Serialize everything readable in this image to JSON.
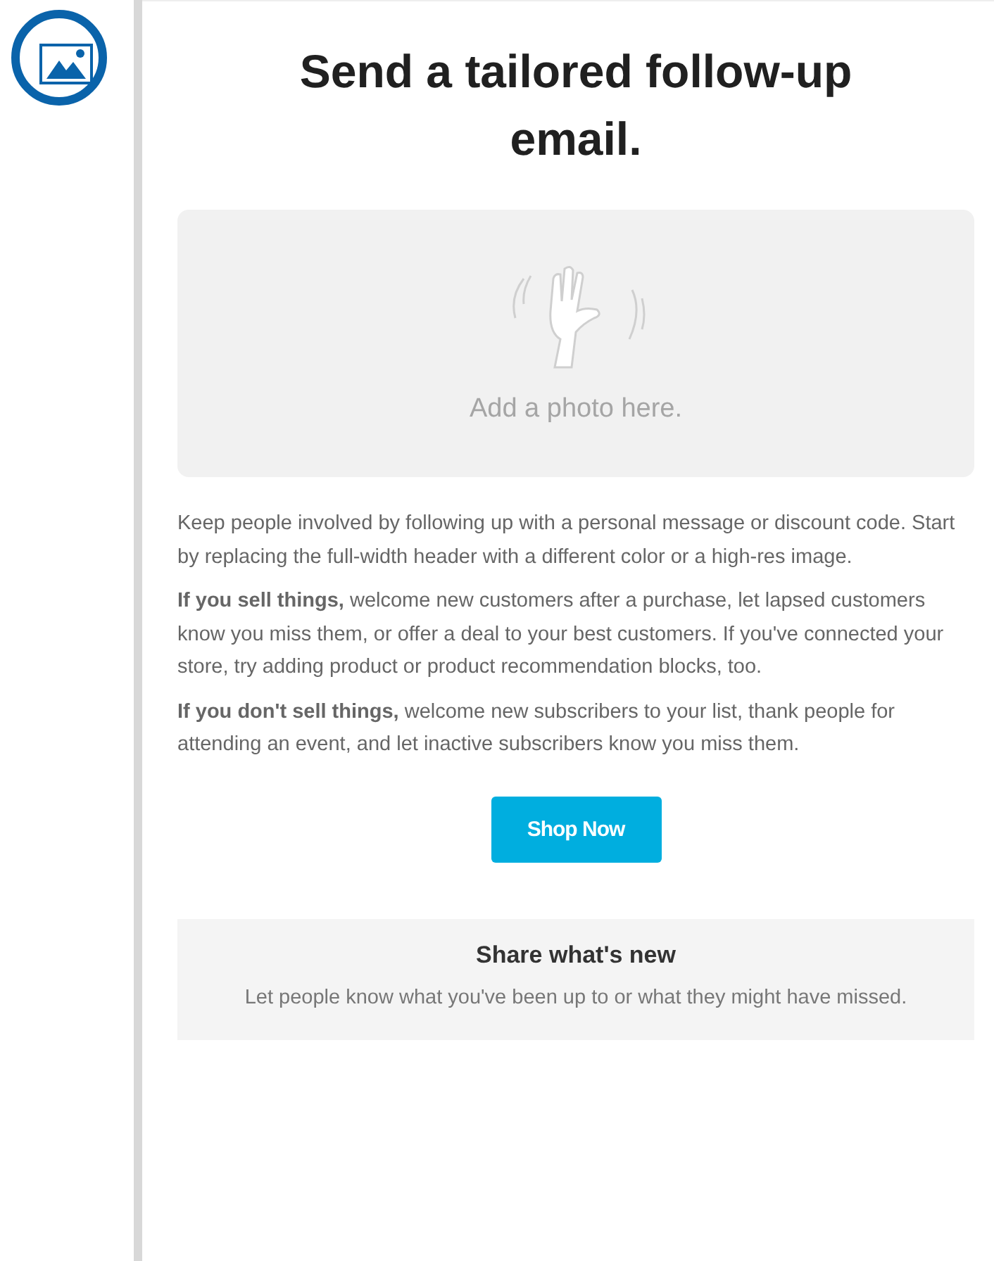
{
  "title": "Send a tailored follow-up email.",
  "image_placeholder": {
    "caption": "Add a photo here."
  },
  "paragraphs": [
    "Keep people involved by following up with a personal message or discount code. Start by replacing the full-width header with a different color or a high-res image.",
    "**If you sell things,** welcome new customers after a purchase, let lapsed customers know you miss them, or offer a deal to your best customers. If you've connected your store, try adding product or product recommendation blocks, too.",
    "**If you don't sell things,** welcome new subscribers to your list, thank people for attending an event, and let inactive subscribers know you miss them."
  ],
  "button": "Shop Now",
  "share": {
    "heading": "Share what's new",
    "text": "Let people know what you've been up to or what they might have missed."
  }
}
